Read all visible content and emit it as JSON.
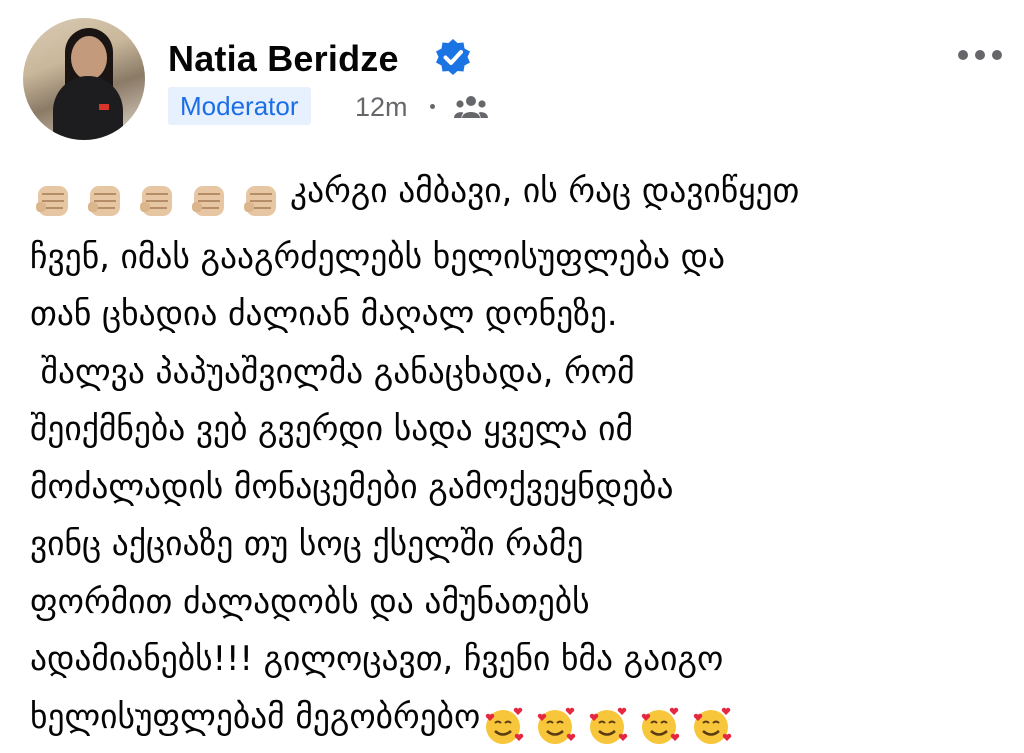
{
  "author": {
    "name": "Natia Beridze",
    "badge": "Moderator",
    "time": "12m"
  },
  "icons": {
    "verified": "verified-badge-icon",
    "audience": "group-icon",
    "more": "more-options-icon"
  },
  "colors": {
    "accent": "#1b6ee6",
    "badge_bg": "#e7f0fd",
    "meta": "#65676b"
  },
  "post": {
    "line1": "კარგი ამბავი, ის რაც დავიწყეთ",
    "line2": "ჩვენ, იმას გააგრძელებს ხელისუფლება და",
    "line3": "თან ცხადია ძალიან მაღალ დონეზე.",
    "line4": " შალვა პაპუაშვილმა განაცხადა, რომ",
    "line5": "შეიქმნება ვებ გვერდი სადა ყველა იმ",
    "line6": "მოძალადის მონაცემები გამოქვეყნდება",
    "line7": "ვინც აქციაზე თუ სოც ქსელში რამე",
    "line8": "ფორმით ძალადობს და ამუნათებს",
    "line9": "ადამიანებს!!! გილოცავთ, ჩვენი ხმა გაიგო",
    "line10": "ხელისუფლებამ მეგობრებო"
  },
  "emojis": {
    "leading": "raised-fist-light-skin-icon",
    "trailing": "smiling-face-with-hearts-icon"
  }
}
